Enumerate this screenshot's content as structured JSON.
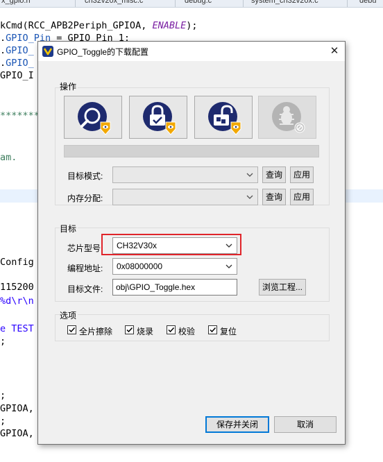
{
  "editor": {
    "tabs": [
      "x_gpio.h",
      "ch32v20x_misc.c",
      "debug.c",
      "system_ch32v20x.c",
      "debu"
    ],
    "lines": [
      {
        "segments": [
          {
            "t": "kCmd(RCC_APB2Periph_GPIOA, ",
            "c": "#000000"
          },
          {
            "t": "ENABLE",
            "c": "#7a1fa2",
            "i": true
          },
          {
            "t": ");",
            "c": "#000000"
          }
        ]
      },
      {
        "segments": [
          {
            "t": ".",
            "c": "#000000"
          },
          {
            "t": "GPIO_Pin",
            "c": "#1a55b5"
          },
          {
            "t": " = GPIO_Pin_1;",
            "c": "#000000"
          }
        ]
      },
      {
        "segments": [
          {
            "t": ".",
            "c": "#000000"
          },
          {
            "t": "GPIO_",
            "c": "#1a55b5"
          }
        ]
      },
      {
        "segments": [
          {
            "t": ".",
            "c": "#000000"
          },
          {
            "t": "GPIO_",
            "c": "#1a55b5"
          }
        ]
      },
      {
        "segments": [
          {
            "t": "GPIO_I",
            "c": "#000000"
          }
        ]
      },
      {
        "segments": [
          {
            "t": "*******",
            "c": "#3f7f5f"
          }
        ]
      },
      {
        "segments": [
          {
            "t": "am.",
            "c": "#3f7f5f"
          }
        ]
      },
      {
        "segments": [
          {
            "t": "Config",
            "c": "#000000"
          }
        ]
      },
      {
        "segments": [
          {
            "t": "115200",
            "c": "#000000"
          }
        ]
      },
      {
        "segments": [
          {
            "t": "%d\\r\\n",
            "c": "#2a00ff"
          }
        ]
      },
      {
        "segments": [
          {
            "t": "e TEST",
            "c": "#2a00ff"
          }
        ]
      },
      {
        "segments": [
          {
            "t": ";",
            "c": "#000000"
          }
        ]
      },
      {
        "segments": [
          {
            "t": ";",
            "c": "#000000"
          }
        ]
      },
      {
        "segments": [
          {
            "t": "GPIOA,",
            "c": "#000000"
          }
        ]
      },
      {
        "segments": [
          {
            "t": ";",
            "c": "#000000"
          }
        ]
      },
      {
        "segments": [
          {
            "t": "GPIOA,",
            "c": "#000000"
          }
        ]
      }
    ]
  },
  "dialog": {
    "title": "GPIO_Toggle的下载配置",
    "close_label": "✕",
    "ops_group": {
      "label": "操作",
      "tools": [
        {
          "name": "query-chip-info-icon",
          "disabled": false
        },
        {
          "name": "lock-protect-icon",
          "disabled": false
        },
        {
          "name": "unlock-protect-icon",
          "disabled": false
        },
        {
          "name": "debug-bug-icon",
          "disabled": true
        }
      ],
      "target_mode_label": "目标模式:",
      "target_mode_value": "",
      "memory_alloc_label": "内存分配:",
      "memory_alloc_value": "",
      "query_label": "查询",
      "apply_label": "应用"
    },
    "target_group": {
      "label": "目标",
      "chip_model_label": "芯片型号:",
      "chip_model_value": "CH32V30x",
      "program_addr_label": "编程地址:",
      "program_addr_value": "0x08000000",
      "target_file_label": "目标文件:",
      "target_file_value": "obj\\GPIO_Toggle.hex",
      "browse_label": "浏览工程..."
    },
    "options_group": {
      "label": "选项",
      "options": [
        {
          "label": "全片擦除",
          "checked": true
        },
        {
          "label": "烧录",
          "checked": true
        },
        {
          "label": "校验",
          "checked": true
        },
        {
          "label": "复位",
          "checked": true
        }
      ]
    },
    "save_close_label": "保存并关闭",
    "cancel_label": "取消"
  },
  "colors": {
    "accent": "#0078d7",
    "highlight_frame": "#e0242a",
    "icon_navy": "#1e2a6e",
    "icon_gold": "#f2a800"
  }
}
